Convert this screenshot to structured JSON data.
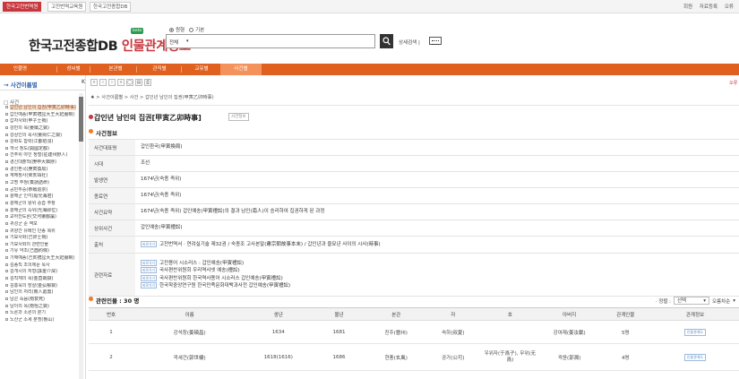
{
  "top_tabs": [
    "한국고전번역원",
    "고전번역교육원",
    "한국고전종합DB"
  ],
  "top_links": [
    "회원",
    "자료등록",
    "오류"
  ],
  "logo": {
    "prefix": "한국고전종합DB ",
    "accent": "인물관계정보",
    "badge": "beta"
  },
  "search": {
    "radio_options": [
      "원형",
      "기본"
    ],
    "selected_radio": "원형",
    "scope": "전체",
    "detail_label": "상세검색 |"
  },
  "nav": {
    "items": [
      "인물명",
      "성씨별",
      "본관별",
      "관직별",
      "교유별",
      "사건별"
    ],
    "active": "사건별"
  },
  "sidebar": {
    "title": "→ 사건이름별",
    "collapse": "K",
    "root": "□ 사건",
    "items": [
      "갑인년 남인의 집권(甲寅乙卯時事)",
      "갑인예송(甲寅禮訟大王大妃服制)",
      "갑자사화(甲子士禍)",
      "강빈의 옥(姜嬪之獄)",
      "강상인의 옥사(姜尙仁之獄)",
      "강화도 함락(江都陷沒)",
      "개국 정도(開國定都)",
      "건주위 야인 정벌(征建州野人)",
      "경신대출척(庚申大黜陟)",
      "경인환국(庚寅換局)",
      "계해정사(癸亥靖社)",
      "고명 주청(奏請誥命)",
      "공빈추숭(恭嬪追崇)",
      "광해군 인각(廢光海君)",
      "광해군의 왕위 승습 주청",
      "광해군의 즉위(光海即位)",
      "교하천도론(交河遷都論)",
      "귀성군 준 역모",
      "귀양간 유배인 단종 복위",
      "기묘사화(己卯士禍)",
      "기묘사화의 관련인물",
      "기유 약조(己酉約條)",
      "기해예송(己亥禮訟大王大妃服制)",
      "김종직 조의제문 옥사",
      "김개시의 처형(誅金介屎)",
      "김직재의 옥(金直哉獄)",
      "김홍욱의 장살(金弘郁獄)",
      "남인의 처리(南人處置)",
      "남곤 죽음(南袞死)",
      "남이의 옥(南怡之獄)",
      "노론과 소론의 분기",
      "노산군 소세 분쟁(魯山)"
    ],
    "selected_index": 0
  },
  "toolbar": {
    "buttons": [
      "«",
      "‹",
      "›",
      "»",
      "◯",
      "▤",
      "⎙"
    ],
    "close": "오류"
  },
  "breadcrumb": "♠ > 사건이름별 > 사건 > 갑인년 남인의 집권(甲寅乙卯時事)",
  "page": {
    "title": "갑인년 남인의 집권[甲寅乙卯時事]",
    "badge": "사건정보"
  },
  "event_info": {
    "heading": "사건정보",
    "rows": [
      {
        "key": "사건대표명",
        "lines": [
          {
            "text": "갑인환국(甲寅換局)"
          }
        ]
      },
      {
        "key": "시대",
        "lines": [
          {
            "text": "조선"
          }
        ]
      },
      {
        "key": "발생연",
        "lines": [
          {
            "text": "1674년(숙종 즉위)"
          }
        ]
      },
      {
        "key": "종료연",
        "lines": [
          {
            "text": "1674년(숙종 즉위)"
          }
        ]
      },
      {
        "key": "사건요약",
        "lines": [
          {
            "text": "1674년(숙종 즉위) 갑인예송(甲寅禮訟)의 결과 남인(南人)이 승리하여 집권하게 된 과정"
          }
        ]
      },
      {
        "key": "상위사건",
        "lines": [
          {
            "text": "갑인예송(甲寅禮訟)"
          }
        ]
      },
      {
        "key": "출처",
        "lines": [
          {
            "tag": "바로가기",
            "text": "고전번역서 · 연려실기술 제32권 / 숙종조 고사본말(肅宗朝故事本末) / 갑인년과 을묘년 사이의 시사(時事)"
          }
        ]
      },
      {
        "key": "관련자료",
        "lines": [
          {
            "tag": "바로가기",
            "text": "고전용어 시소러스 : 갑인예송(甲寅禮訟)"
          },
          {
            "tag": "바로가기",
            "text": "국사편찬위원회 우리역사넷 예송(禮訟)"
          },
          {
            "tag": "바로가기",
            "text": "국사편찬위원회 한국역사용어 시소러스 갑인예송(甲寅禮訟)"
          },
          {
            "tag": "바로가기",
            "text": "한국학중앙연구원 한국민족문화대백과사전 갑인예송(甲寅禮訟)"
          }
        ]
      }
    ]
  },
  "related": {
    "heading": "관련인물 : 30 명",
    "sort_label": "· 정렬 :",
    "sort_value": "선택",
    "order_value": "오름차순",
    "columns": [
      "번호",
      "이름",
      "생년",
      "몰년",
      "본관",
      "자",
      "호",
      "아버지",
      "관계인물",
      "관계정보"
    ],
    "rows": [
      [
        "1",
        "강석창(姜碩昌)",
        "1634",
        "1681",
        "진주(晉州)",
        "숙하(叔夏)",
        "",
        "강여재(姜汝載)",
        "5명",
        "인물관계도"
      ],
      [
        "2",
        "곽세건(郭世楗)",
        "1618(1616)",
        "1686",
        "현풍(玄風)",
        "공가(公可)",
        "우위자(于爲子), 무위(无爲)",
        "곽윤(郭潤)",
        "4명",
        "인물관계도"
      ]
    ]
  },
  "colors": {
    "brand_red": "#c8373e",
    "nav_orange": "#e0601f",
    "nav_active": "#f5925c",
    "link_blue": "#5b8cc9"
  }
}
